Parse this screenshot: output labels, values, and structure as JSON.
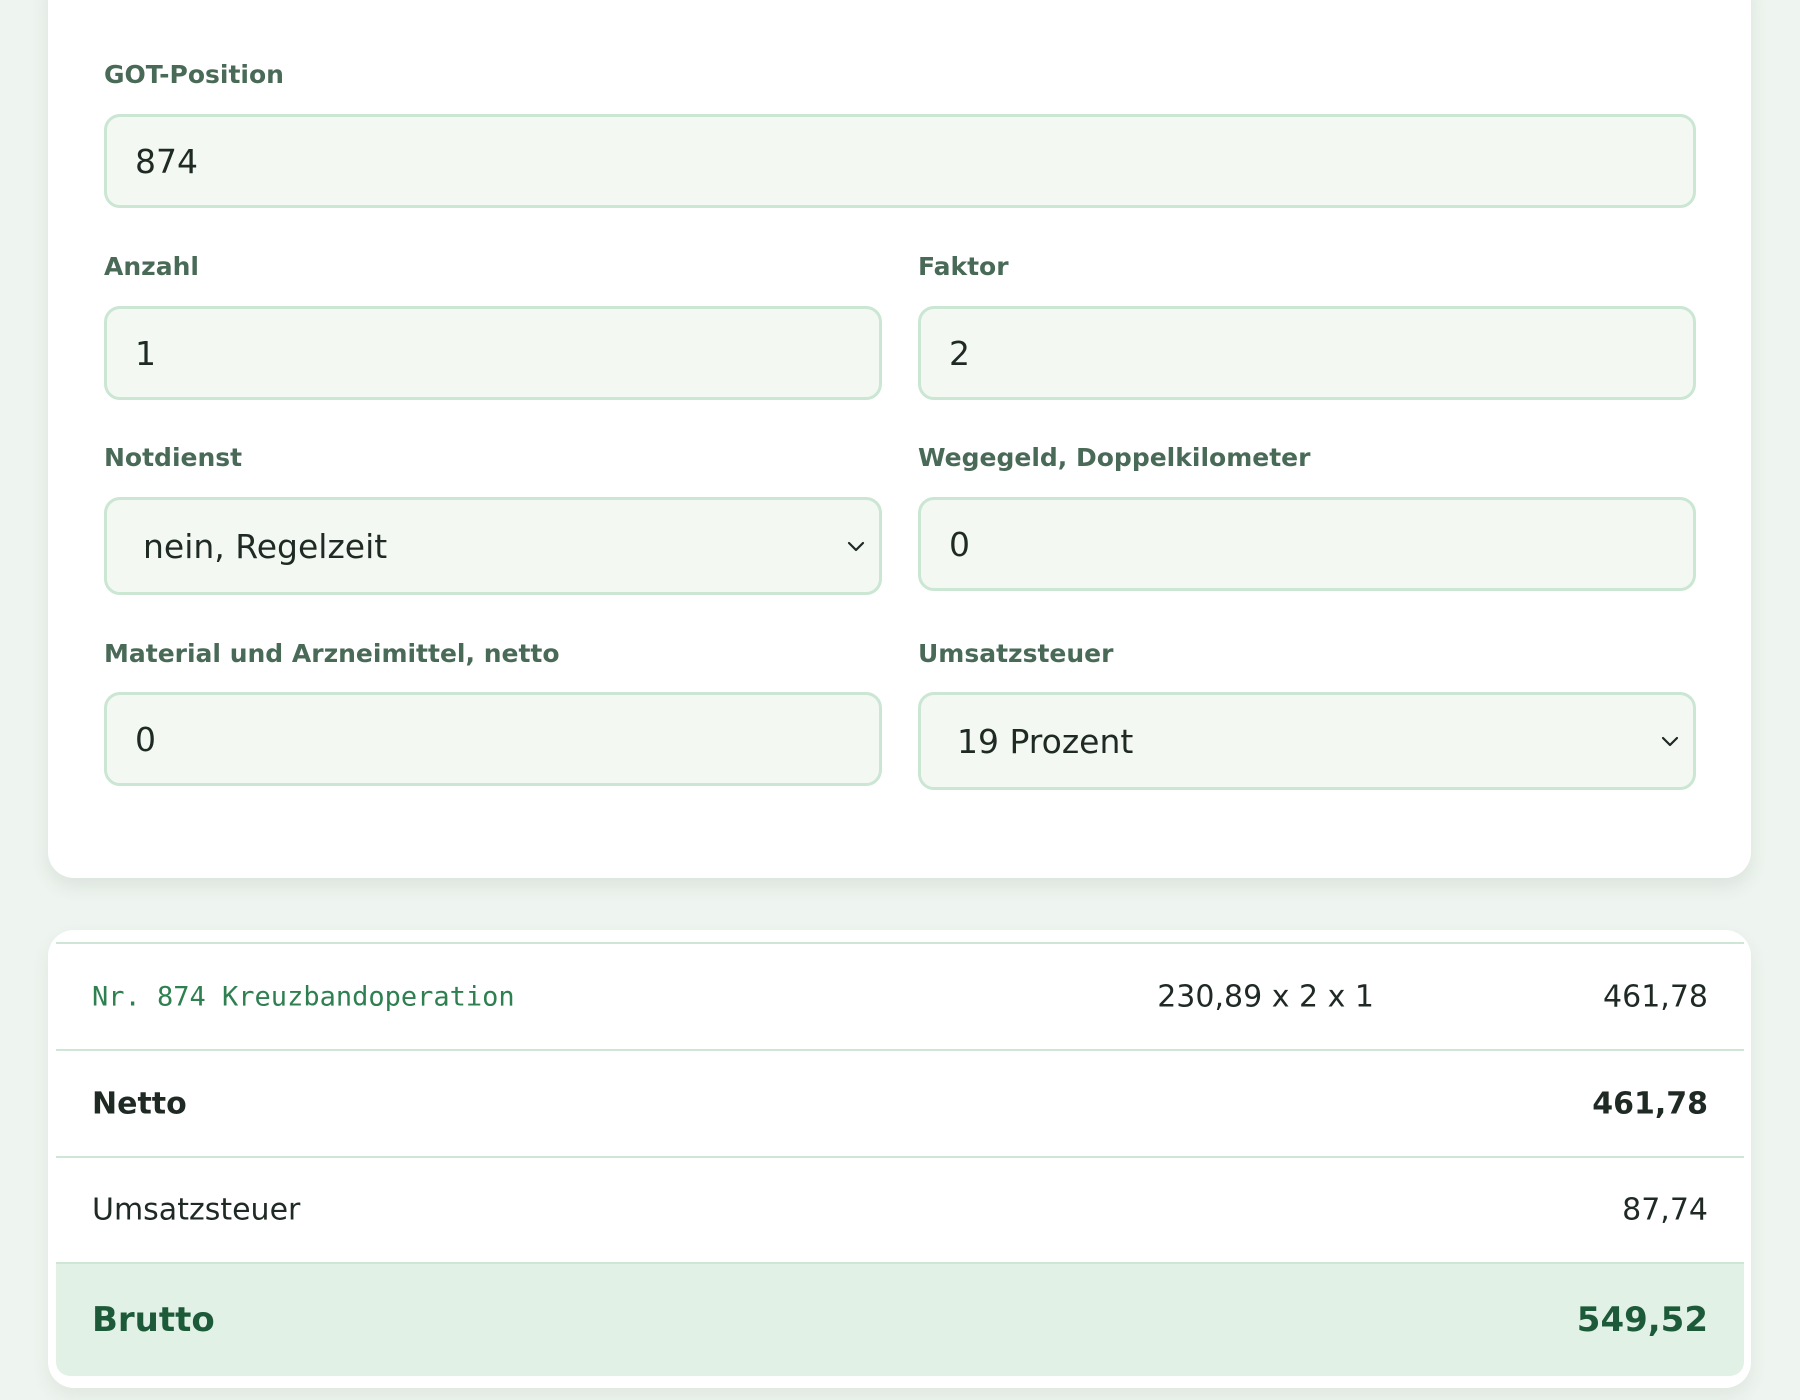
{
  "form": {
    "got_position": {
      "label": "GOT-Position",
      "value": "874"
    },
    "anzahl": {
      "label": "Anzahl",
      "value": "1"
    },
    "faktor": {
      "label": "Faktor",
      "value": "2"
    },
    "notdienst": {
      "label": "Notdienst",
      "value": "nein, Regelzeit"
    },
    "wegegeld": {
      "label": "Wegegeld, Doppelkilometer",
      "value": "0"
    },
    "material": {
      "label": "Material und Arzneimittel, netto",
      "value": "0"
    },
    "umsatzsteuer": {
      "label": "Umsatzsteuer",
      "value": "19 Prozent"
    }
  },
  "results": {
    "positions": [
      {
        "description": "Nr. 874 Kreuzbandoperation",
        "calculation": "230,89 x 2 x 1",
        "amount": "461,78"
      }
    ],
    "netto": {
      "label": "Netto",
      "value": "461,78"
    },
    "umsatzsteuer": {
      "label": "Umsatzsteuer",
      "value": "87,74"
    },
    "brutto": {
      "label": "Brutto",
      "value": "549,52"
    }
  },
  "icons": {
    "select_arrow": "chevron-down-icon"
  },
  "colors": {
    "background": "#eef4ef",
    "card": "#ffffff",
    "input_background": "#f3f8f3",
    "input_border": "#cbe6d3",
    "label": "#4a6a58",
    "accent_green": "#2e8050",
    "brutto_background": "#e2f1e5",
    "brutto_text": "#1d5a3a"
  }
}
